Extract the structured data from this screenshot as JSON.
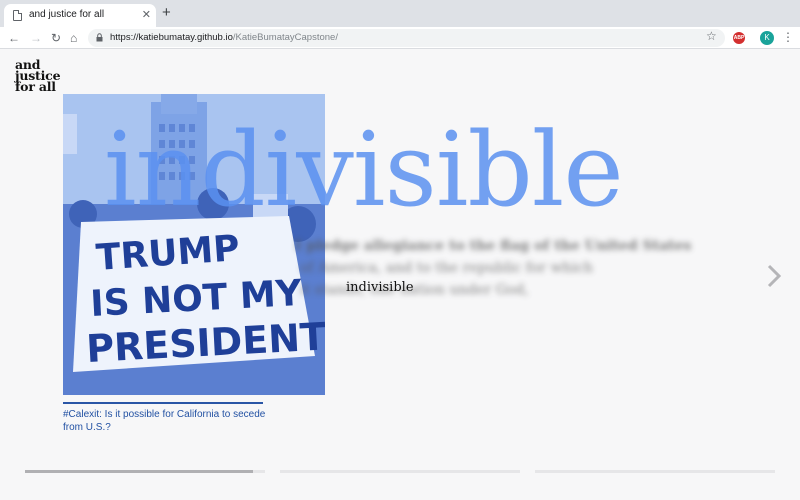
{
  "browser": {
    "tab_title": "and justice for all",
    "tab_close": "✕",
    "new_tab": "+",
    "url_host": "https://katiebumatay.github.io",
    "url_path": "/KatieBumatayCapstone/",
    "back": "←",
    "forward": "→",
    "reload": "↻",
    "home": "⌂",
    "star": "☆",
    "abp_label": "ABP",
    "profile_initial": "K",
    "menu": "⋮"
  },
  "site": {
    "logo_line1": "and",
    "logo_line2": "justice",
    "logo_line3": "for all",
    "headline": "indivisible",
    "inline_word": "indivisible",
    "blurred_line1": "I pledge allegiance to the flag of the United States",
    "blurred_line2": "of America, and to the republic for which",
    "blurred_line3": "it stands, one nation under God,",
    "caption": "#Calexit: Is it possible for California to secede from U.S.?",
    "sign_line1": "TRUMP",
    "sign_line2": "IS NOT MY",
    "sign_line3": "PRESIDENT"
  },
  "slides": {
    "count": 3,
    "progress": [
      0.95,
      0.0,
      0.0
    ]
  },
  "colors": {
    "accent_blue": "#5a91f0",
    "caption_blue": "#2251a3",
    "photo_tint": "#8fb2e8"
  }
}
